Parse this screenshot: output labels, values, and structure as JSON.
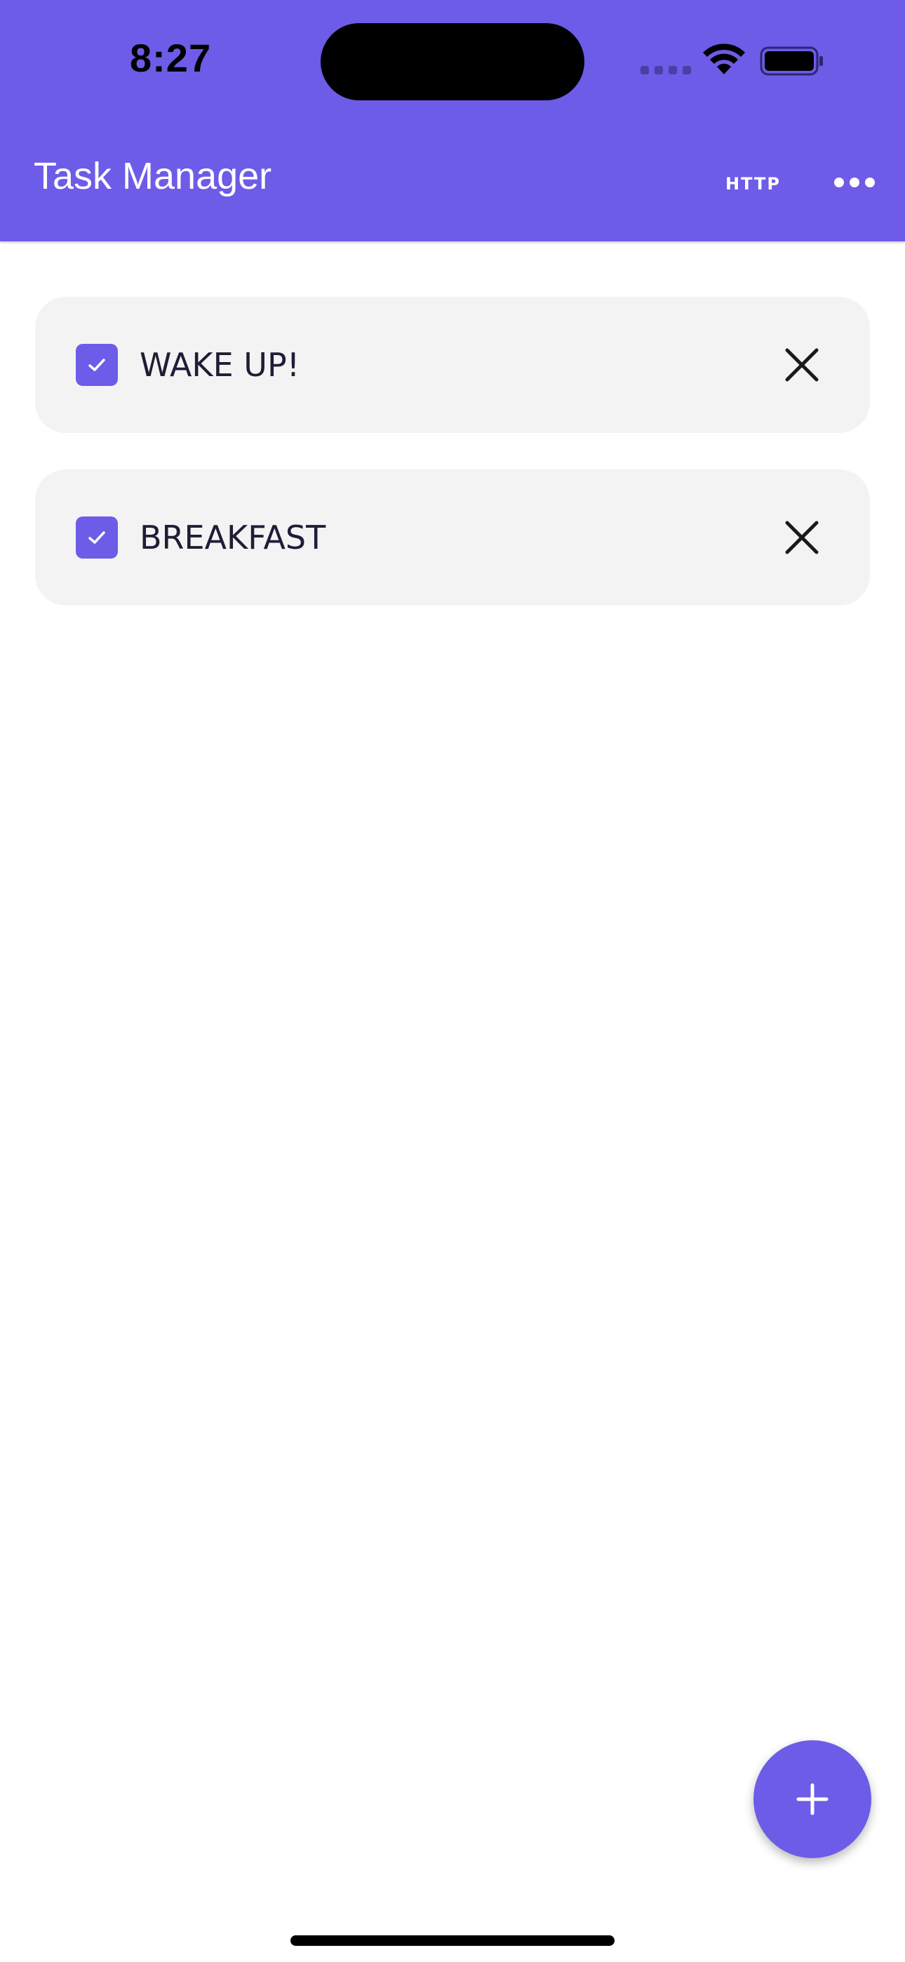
{
  "status_bar": {
    "time": "8:27"
  },
  "app_bar": {
    "title": "Task Manager",
    "http_label": "HTTP",
    "more_icon": "more-horizontal-icon"
  },
  "tasks": [
    {
      "label": "WAKE UP!",
      "checked": true
    },
    {
      "label": "BREAKFAST",
      "checked": true
    }
  ],
  "fab": {
    "icon": "plus-icon"
  },
  "colors": {
    "primary": "#6C5CE7",
    "card_background": "#F3F3F3",
    "task_text": "#1f1d36"
  }
}
